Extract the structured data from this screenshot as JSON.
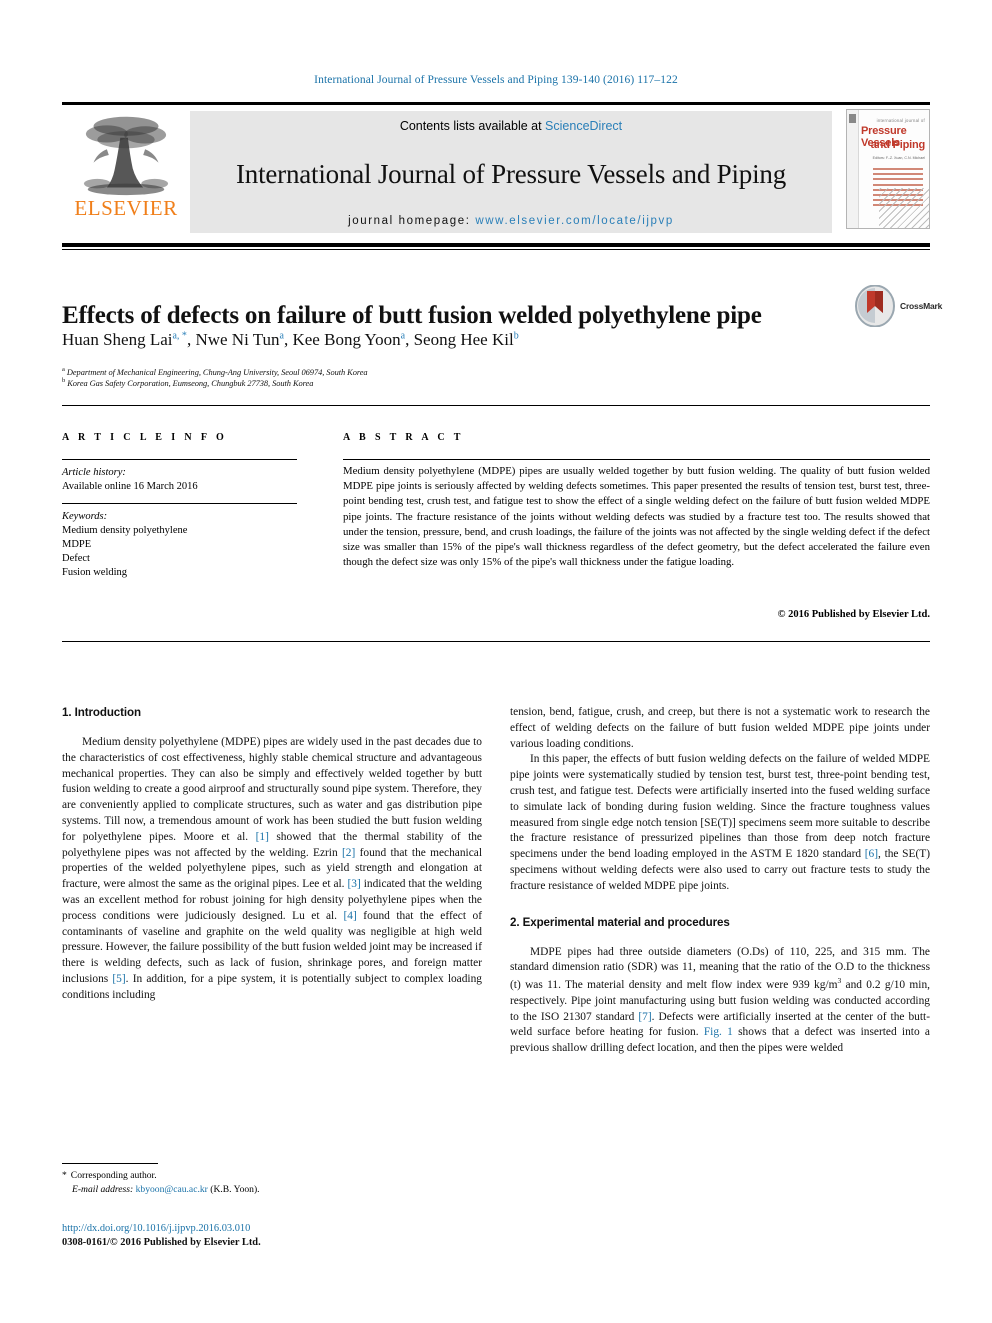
{
  "running_head": "International Journal of Pressure Vessels and Piping 139-140 (2016) 117–122",
  "masthead": {
    "publisher_name": "ELSEVIER",
    "contents_prefix": "Contents lists available at ",
    "contents_link": "ScienceDirect",
    "journal_title": "International Journal of Pressure Vessels and Piping",
    "homepage_prefix": "journal homepage: ",
    "homepage_url": "www.elsevier.com/locate/ijpvp",
    "cover": {
      "kicker": "international journal of",
      "title_line1": "Pressure Vessels",
      "title_line2": "and Piping",
      "subtitle": "Editors: F.-Z. Xuan, C.N. Michael"
    }
  },
  "article": {
    "title": "Effects of defects on failure of butt fusion welded polyethylene pipe",
    "crossmark_label": "CrossMark",
    "authors": [
      {
        "name": "Huan Sheng Lai",
        "marks": "a, *"
      },
      {
        "name": "Nwe Ni Tun",
        "marks": "a"
      },
      {
        "name": "Kee Bong Yoon",
        "marks": "a"
      },
      {
        "name": "Seong Hee Kil",
        "marks": "b"
      }
    ],
    "affiliations": [
      {
        "mark": "a",
        "text": "Department of Mechanical Engineering, Chung-Ang University, Seoul 06974, South Korea"
      },
      {
        "mark": "b",
        "text": "Korea Gas Safety Corporation, Eumseong, Chungbuk 27738, South Korea"
      }
    ]
  },
  "article_info": {
    "heading": "A R T I C L E   I N F O",
    "history_label": "Article history:",
    "history_value": "Available online 16 March 2016",
    "keywords_label": "Keywords:",
    "keywords": [
      "Medium density polyethylene",
      "MDPE",
      "Defect",
      "Fusion welding"
    ]
  },
  "abstract": {
    "heading": "A B S T R A C T",
    "text": "Medium density polyethylene (MDPE) pipes are usually welded together by butt fusion welding. The quality of butt fusion welded MDPE pipe joints is seriously affected by welding defects sometimes. This paper presented the results of tension test, burst test, three-point bending test, crush test, and fatigue test to show the effect of a single welding defect on the failure of butt fusion welded MDPE pipe joints. The fracture resistance of the joints without welding defects was studied by a fracture test too. The results showed that under the tension, pressure, bend, and crush loadings, the failure of the joints was not affected by the single welding defect if the defect size was smaller than 15% of the pipe's wall thickness regardless of the defect geometry, but the defect accelerated the failure even though the defect size was only 15% of the pipe's wall thickness under the fatigue loading.",
    "copyright": "© 2016 Published by Elsevier Ltd."
  },
  "body": {
    "section1_heading": "1.  Introduction",
    "section2_heading": "2.  Experimental material and procedures",
    "left_p1_a": "Medium density polyethylene (MDPE) pipes are widely used in the past decades due to the characteristics of cost effectiveness, highly stable chemical structure and advantageous mechanical properties. They can also be simply and effectively welded together by butt fusion welding to create a good airproof and structurally sound pipe system. Therefore, they are conveniently applied to complicate structures, such as water and gas distribution pipe systems. Till now, a tremendous amount of work has been studied the butt fusion welding for polyethylene pipes. Moore et al. ",
    "left_p1_r1": "[1]",
    "left_p1_b": " showed that the thermal stability of the polyethylene pipes was not affected by the welding. Ezrin ",
    "left_p1_r2": "[2]",
    "left_p1_c": " found that the mechanical properties of the welded polyethylene pipes, such as yield strength and elongation at fracture, were almost the same as the original pipes. Lee et al. ",
    "left_p1_r3": "[3]",
    "left_p1_d": " indicated that the welding was an excellent method for robust joining for high density polyethylene pipes when the process conditions were judiciously designed. Lu et al. ",
    "left_p1_r4": "[4]",
    "left_p1_e": " found that the effect of contaminants of vaseline and graphite on the weld quality was negligible at high weld pressure. However, the failure possibility of the butt fusion welded joint may be increased if there is welding defects, such as lack of fusion, shrinkage pores, and foreign matter inclusions ",
    "left_p1_r5": "[5]",
    "left_p1_f": ". In addition, for a pipe system, it is potentially subject to complex loading conditions including",
    "right_p1": "tension, bend, fatigue, crush, and creep, but there is not a systematic work to research the effect of welding defects on the failure of butt fusion welded MDPE pipe joints under various loading conditions.",
    "right_p2_a": "In this paper, the effects of butt fusion welding defects on the failure of welded MDPE pipe joints were systematically studied by tension test, burst test, three-point bending test, crush test, and fatigue test. Defects were artificially inserted into the fused welding surface to simulate lack of bonding during fusion welding. Since the fracture toughness values measured from single edge notch tension [SE(T)] specimens seem more suitable to describe the fracture resistance of pressurized pipelines than those from deep notch fracture specimens under the bend loading employed in the ASTM E 1820 standard ",
    "right_p2_r1": "[6]",
    "right_p2_b": ", the SE(T) specimens without welding defects were also used to carry out fracture tests to study the fracture resistance of welded MDPE pipe joints.",
    "right_p3_a": "MDPE pipes had three outside diameters (O.Ds) of 110, 225, and 315 mm. The standard dimension ratio (SDR) was 11, meaning that the ratio of the O.D to the thickness (t) was 11. The material density and melt flow index were 939 kg/m",
    "right_p3_sup": "3",
    "right_p3_b": " and 0.2 g/10 min, respectively. Pipe joint manufacturing using butt fusion welding was conducted according to the ISO 21307 standard ",
    "right_p3_r1": "[7]",
    "right_p3_c": ". Defects were artificially inserted at the center of the butt-weld surface before heating for fusion. ",
    "right_p3_r2": "Fig. 1",
    "right_p3_d": " shows that a defect was inserted into a previous shallow drilling defect location, and then the pipes were welded"
  },
  "footer": {
    "corresponding_star": "*",
    "corresponding_label": "Corresponding author.",
    "email_label": "E-mail address:",
    "email": "kbyoon@cau.ac.kr",
    "email_suffix": "(K.B. Yoon).",
    "doi_url": "http://dx.doi.org/10.1016/j.ijpvp.2016.03.010",
    "issn_line": "0308-0161/© 2016 Published by Elsevier Ltd."
  },
  "colors": {
    "link": "#1a72a8",
    "elsevier_orange": "#f07f1a",
    "cover_red": "#c0392b"
  }
}
